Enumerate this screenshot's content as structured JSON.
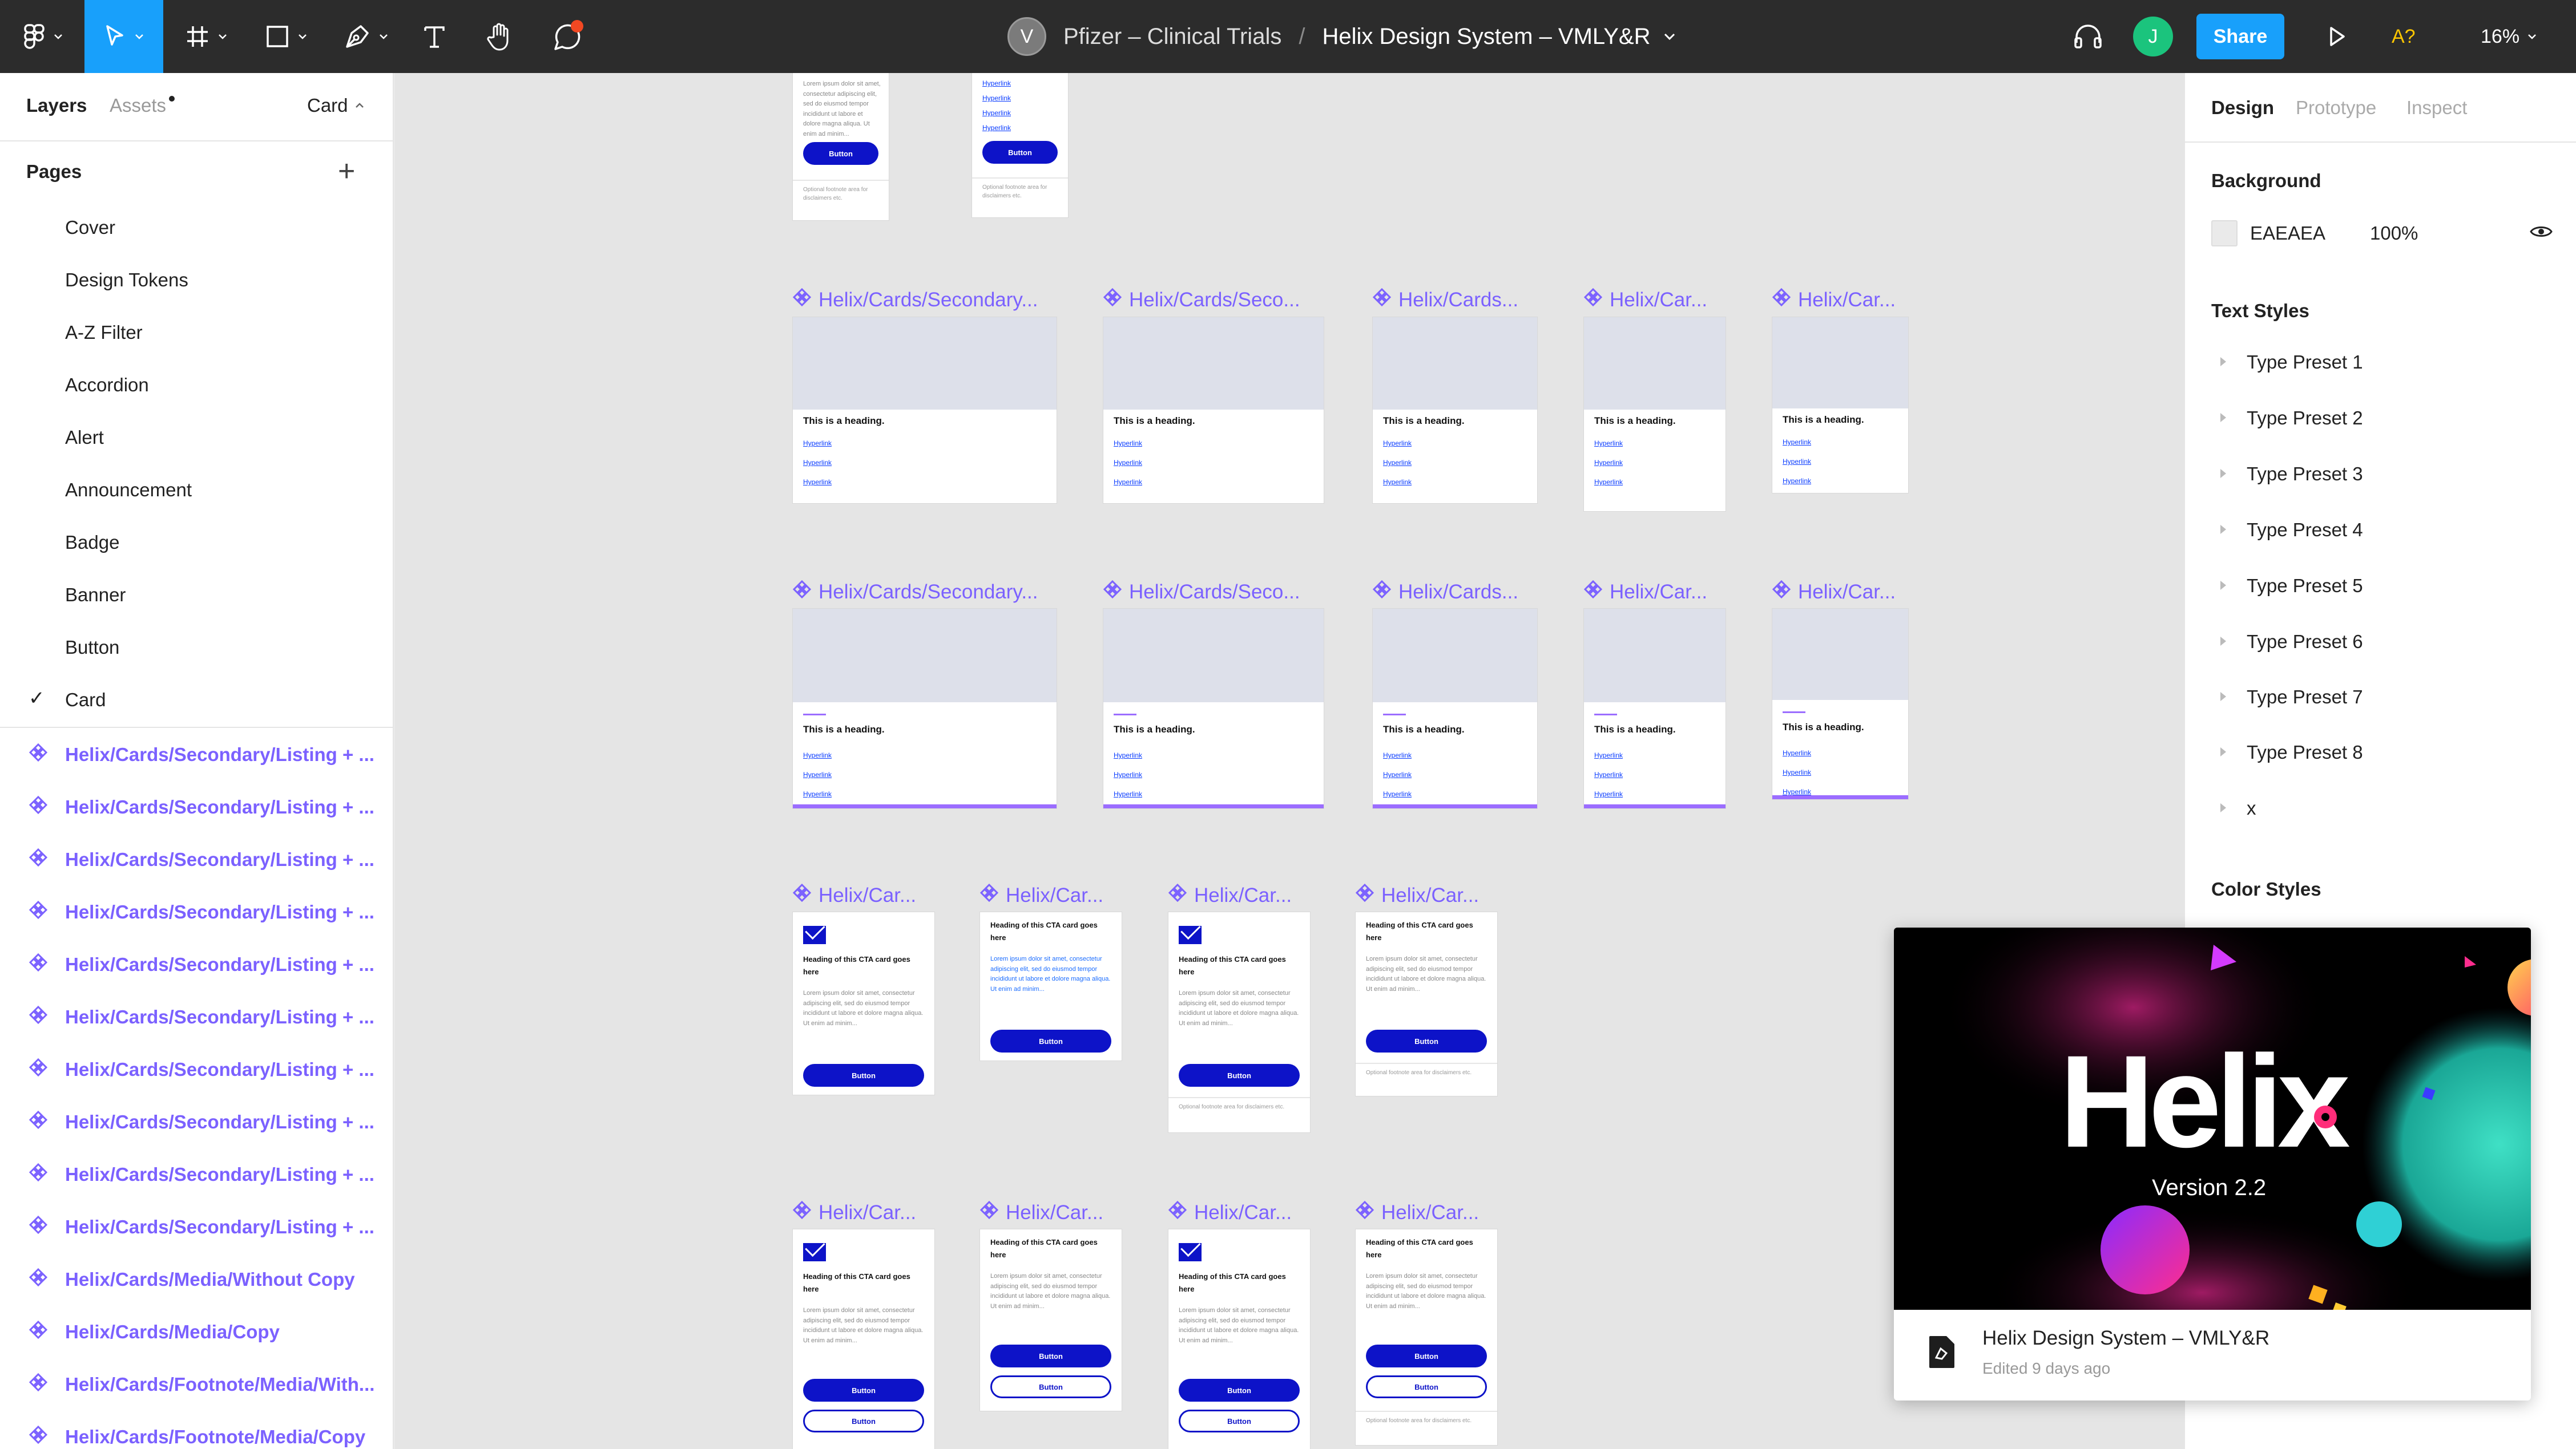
{
  "toolbar": {
    "file_avatar": "V",
    "project": "Pfizer – Clinical Trials",
    "separator": "/",
    "file_name": "Helix Design System – VMLY&R",
    "share_label": "Share",
    "user_initial": "J",
    "a11y_label": "A?",
    "zoom_label": "16%",
    "icons": [
      "figma-menu-icon",
      "move-tool-icon",
      "frame-tool-icon",
      "shape-tool-icon",
      "pen-tool-icon",
      "text-tool-icon",
      "hand-tool-icon",
      "comment-tool-icon",
      "headphones-icon",
      "present-play-icon"
    ]
  },
  "left_panel": {
    "tabs": {
      "layers": "Layers",
      "assets": "Assets",
      "page_picker": "Card"
    },
    "pages_title": "Pages",
    "pages_add": "+",
    "pages": [
      "Cover",
      "Design Tokens",
      "A-Z Filter",
      "Accordion",
      "Alert",
      "Announcement",
      "Badge",
      "Banner",
      "Button",
      "Card"
    ],
    "current_page": "Card",
    "layers": [
      "Helix/Cards/Secondary/Listing + ...",
      "Helix/Cards/Secondary/Listing + ...",
      "Helix/Cards/Secondary/Listing + ...",
      "Helix/Cards/Secondary/Listing + ...",
      "Helix/Cards/Secondary/Listing + ...",
      "Helix/Cards/Secondary/Listing + ...",
      "Helix/Cards/Secondary/Listing + ...",
      "Helix/Cards/Secondary/Listing + ...",
      "Helix/Cards/Secondary/Listing + ...",
      "Helix/Cards/Secondary/Listing + ...",
      "Helix/Cards/Media/Without Copy",
      "Helix/Cards/Media/Copy",
      "Helix/Cards/Footnote/Media/With...",
      "Helix/Cards/Footnote/Media/Copy"
    ]
  },
  "right_panel": {
    "tabs": {
      "design": "Design",
      "prototype": "Prototype",
      "inspect": "Inspect"
    },
    "background_title": "Background",
    "background_hex": "EAEAEA",
    "background_opacity": "100%",
    "text_styles_title": "Text Styles",
    "text_styles": [
      "Type Preset 1",
      "Type Preset 2",
      "Type Preset 3",
      "Type Preset 4",
      "Type Preset 5",
      "Type Preset 6",
      "Type Preset 7",
      "Type Preset 8",
      "x"
    ],
    "color_styles_title": "Color Styles"
  },
  "canvas": {
    "row1_labels": [
      "Helix/Cards/Secondary...",
      "Helix/Cards/Seco...",
      "Helix/Cards...",
      "Helix/Car...",
      "Helix/Car..."
    ],
    "row2_labels": [
      "Helix/Cards/Secondary...",
      "Helix/Cards/Seco...",
      "Helix/Cards...",
      "Helix/Car...",
      "Helix/Car..."
    ],
    "row3_labels": [
      "Helix/Car...",
      "Helix/Car...",
      "Helix/Car...",
      "Helix/Car..."
    ],
    "row4_labels": [
      "Helix/Car...",
      "Helix/Car...",
      "Helix/Car...",
      "Helix/Car..."
    ],
    "card_heading": "This is a heading.",
    "hyperlink": "Hyperlink",
    "cta_heading": "Heading of this CTA card goes here",
    "cta_body": "Lorem ipsum dolor sit amet, consectetur adipiscing elit, sed do eiusmod tempor incididunt ut labore et dolore magna aliqua. Ut enim ad minim...",
    "button_label": "Button",
    "footnote": "Optional footnote area for disclaimers etc."
  },
  "popup": {
    "thumb_title": "Helix",
    "thumb_version": "Version 2.2",
    "file_name": "Helix Design System – VMLY&R",
    "edited": "Edited 9 days ago"
  },
  "colors": {
    "toolbar_bg": "#2c2c2c",
    "accent_blue": "#18a0fb",
    "component_purple": "#7b61ff",
    "canvas_bg": "#e5e5e5",
    "button_navy": "#0d13c8"
  }
}
